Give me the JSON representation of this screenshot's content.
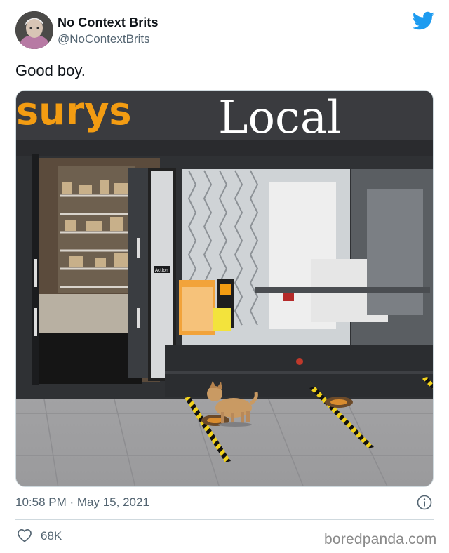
{
  "author": {
    "display_name": "No Context Brits",
    "handle": "@NoContextBrits"
  },
  "tweet": {
    "text": "Good boy.",
    "timestamp": "10:58 PM · May 15, 2021"
  },
  "media": {
    "sign_text": "sburys Local",
    "door_label": "Action"
  },
  "engagement": {
    "likes": "68K"
  },
  "watermark": "boredpanda.com",
  "icons": {
    "logo": "twitter-bird-icon",
    "info": "info-icon",
    "like": "heart-icon"
  },
  "colors": {
    "twitter_blue": "#1d9bf0",
    "secondary_text": "#536471",
    "sign_orange": "#f39c12"
  }
}
